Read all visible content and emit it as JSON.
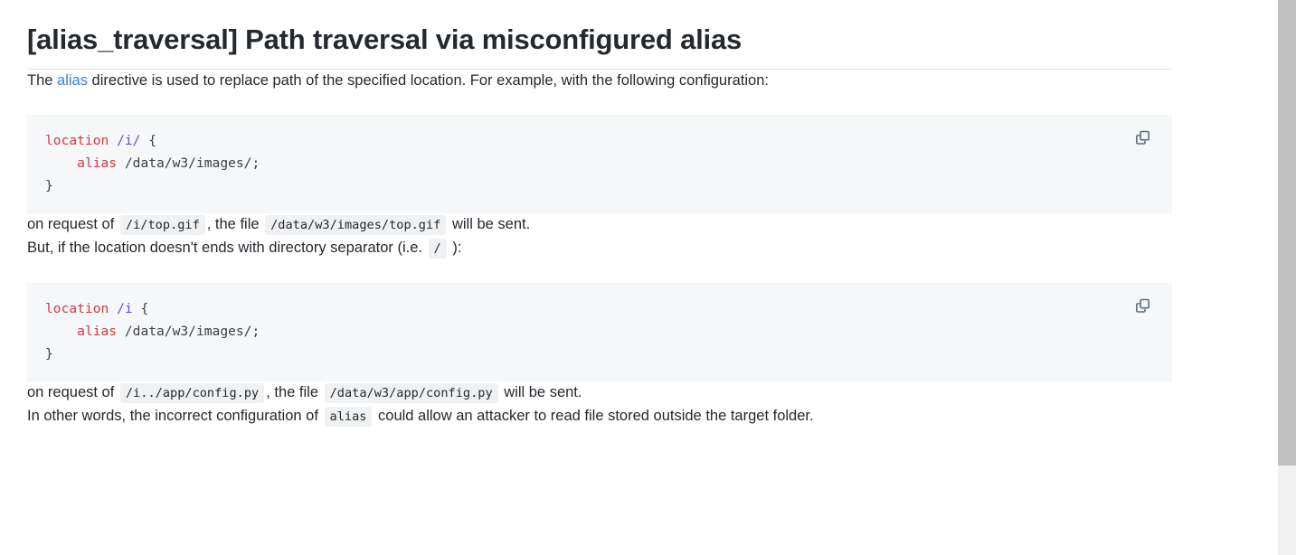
{
  "page": {
    "title": "[alias_traversal] Path traversal via misconfigured alias"
  },
  "paragraphs": {
    "p1_before": "The ",
    "p1_link": "alias",
    "p1_after": " directive is used to replace path of the specified location. For example, with the following configuration:",
    "p2_t1": "on request of ",
    "p2_code1": "/i/top.gif",
    "p2_t2": ", the file ",
    "p2_code2": "/data/w3/images/top.gif",
    "p2_t3": " will be sent.",
    "p3_t1": "But, if the location doesn't ends with directory separator (i.e. ",
    "p3_code1": "/",
    "p3_t2": " ):",
    "p4_t1": "on request of ",
    "p4_code1": "/i../app/config.py",
    "p4_t2": ", the file ",
    "p4_code2": "/data/w3/app/config.py",
    "p4_t3": " will be sent.",
    "p5_t1": "In other words, the incorrect configuration of ",
    "p5_code1": "alias",
    "p5_t2": " could allow an attacker to read file stored outside the target folder."
  },
  "code_blocks": [
    {
      "name": "nginx-config-with-trailing-slash",
      "line1_kw": "location",
      "line1_path": "/i/",
      "line1_brace": " {",
      "line2_indent": "    ",
      "line2_kw": "alias",
      "line2_value": " /data/w3/images/;",
      "line3": "}",
      "copy_label": "copy-icon"
    },
    {
      "name": "nginx-config-without-trailing-slash",
      "line1_kw": "location",
      "line1_path": "/i",
      "line1_brace": " {",
      "line2_indent": "    ",
      "line2_kw": "alias",
      "line2_value": " /data/w3/images/;",
      "line3": "}",
      "copy_label": "copy-icon"
    }
  ],
  "colors": {
    "keyword": "#cf3a45",
    "path": "#6a4ad0",
    "link": "#3b7dd8",
    "text": "#24292e",
    "code_bg": "#f6f7f8",
    "inline_code_bg": "#f0f1f2",
    "scrollbar_thumb": "#c1c1c1",
    "scrollbar_track": "#f1f1f1",
    "rule": "#dfe2e6",
    "icon": "#5c6b7a"
  },
  "scrollbar": {
    "thumb_top_px": "0",
    "thumb_height_px": "515"
  }
}
